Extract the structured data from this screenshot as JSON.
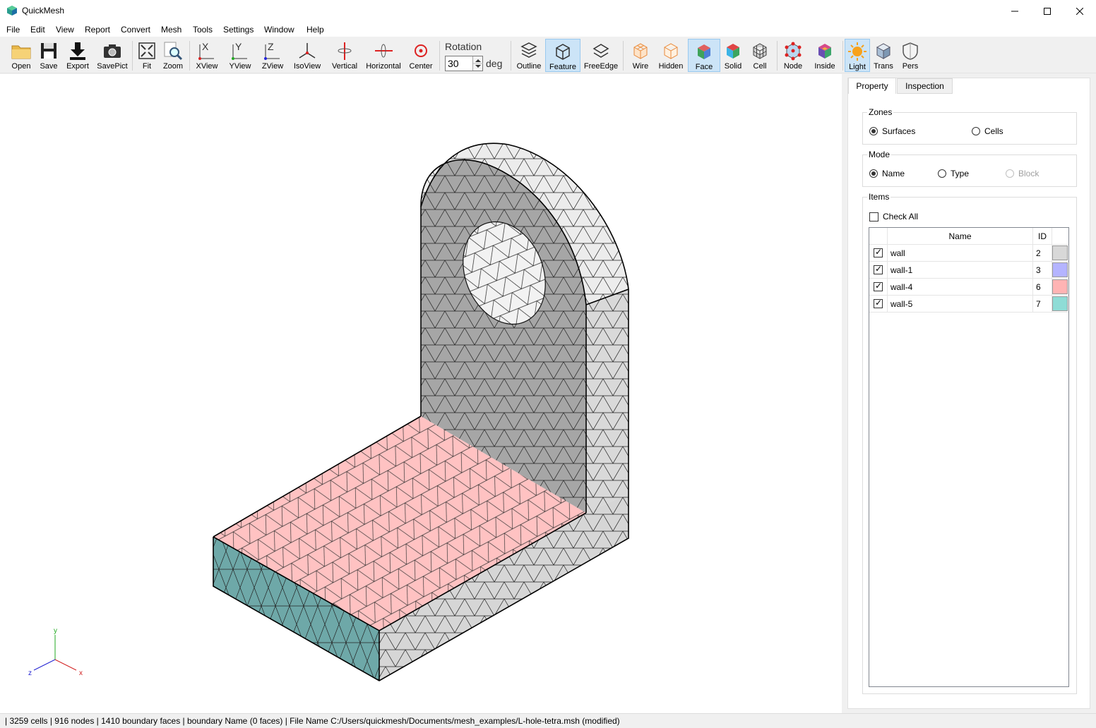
{
  "window": {
    "title": "QuickMesh"
  },
  "menu": [
    "File",
    "Edit",
    "View",
    "Report",
    "Convert",
    "Mesh",
    "Tools",
    "Settings",
    "Window",
    "Help"
  ],
  "toolbar": {
    "open": "Open",
    "save": "Save",
    "export": "Export",
    "savepict": "SavePict",
    "fit": "Fit",
    "zoom": "Zoom",
    "xview": "XView",
    "yview": "YView",
    "zview": "ZView",
    "isoview": "IsoView",
    "vertical": "Vertical",
    "horizontal": "Horizontal",
    "center": "Center",
    "rotation_label": "Rotation",
    "rotation_value": "30",
    "rotation_unit": "deg",
    "outline": "Outline",
    "feature": "Feature",
    "freeedge": "FreeEdge",
    "wire": "Wire",
    "hidden": "Hidden",
    "face": "Face",
    "solid": "Solid",
    "cell": "Cell",
    "node": "Node",
    "inside": "Inside",
    "light": "Light",
    "trans": "Trans",
    "pers": "Pers"
  },
  "panel": {
    "tabs": [
      "Property",
      "Inspection"
    ],
    "zones": {
      "title": "Zones",
      "surfaces": "Surfaces",
      "cells": "Cells",
      "selected": "Surfaces"
    },
    "mode": {
      "title": "Mode",
      "name": "Name",
      "type": "Type",
      "block": "Block",
      "selected": "Name"
    },
    "items": {
      "title": "Items",
      "check_all": "Check All",
      "col_name": "Name",
      "col_id": "ID",
      "rows": [
        {
          "name": "wall",
          "id": "2",
          "color": "#d8d8d8",
          "checked": true
        },
        {
          "name": "wall-1",
          "id": "3",
          "color": "#b4b4ff",
          "checked": true
        },
        {
          "name": "wall-4",
          "id": "6",
          "color": "#ffb4b4",
          "checked": true
        },
        {
          "name": "wall-5",
          "id": "7",
          "color": "#8fdcd6",
          "checked": true
        }
      ]
    }
  },
  "axes": {
    "x": "x",
    "y": "y",
    "z": "z"
  },
  "status": "| 3259 cells | 916 nodes | 1410 boundary faces |  boundary Name  (0 faces) | File Name C:/Users/quickmesh/Documents/mesh_examples/L-hole-tetra.msh (modified)",
  "colors": {
    "pink_face": "#ffc2c2",
    "teal_face": "#6ea8a8",
    "gray_face": "#a6a6a6",
    "light_face": "#d9d9d9",
    "white_face": "#f2f2f2",
    "active_button": "#cce4f7"
  }
}
